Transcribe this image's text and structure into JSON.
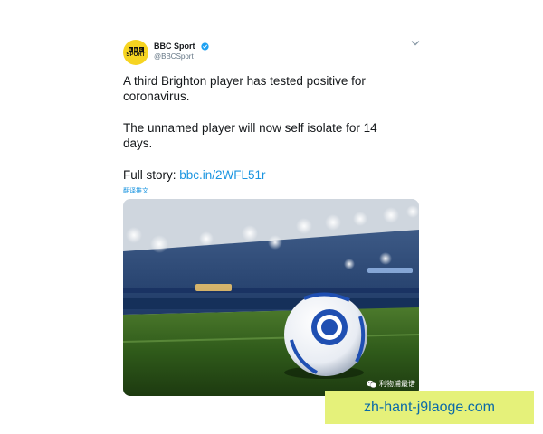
{
  "account": {
    "display_name": "BBC Sport",
    "handle": "@BBCSport",
    "avatar_blocks": [
      "B",
      "B",
      "C"
    ],
    "avatar_label": "SPORT",
    "verified": true
  },
  "tweet": {
    "paragraph_1": "A third Brighton player has tested positive for coronavirus.",
    "paragraph_2": "The unnamed player will now self isolate for 14 days.",
    "full_story_label": "Full story: ",
    "link_text": "bbc.in/2WFL51r",
    "translate_label": "翻译推文"
  },
  "media": {
    "watermark_text": "利物浦最谱"
  },
  "footer": {
    "banner_text": "zh-hant-j9laoge.com"
  },
  "colors": {
    "link": "#1b95e0",
    "verified": "#1da1f2",
    "avatar_bg": "#f6d421",
    "banner_bg": "#e5f17a",
    "banner_text": "#0b6aa8"
  },
  "icons": [
    "verified-badge-icon",
    "chevron-down-icon",
    "wechat-icon"
  ]
}
